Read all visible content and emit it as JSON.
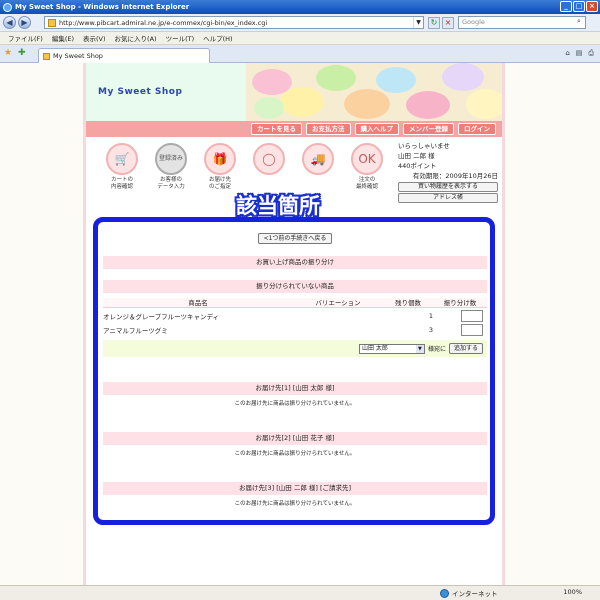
{
  "window": {
    "title": "My Sweet Shop - Windows Internet Explorer"
  },
  "browser": {
    "url": "http://www.pibcart.admiral.ne.jp/e-commex/cgi-bin/ex_index.cgi",
    "search_placeholder": "Google",
    "menu": [
      "ファイル(F)",
      "編集(E)",
      "表示(V)",
      "お気に入り(A)",
      "ツール(T)",
      "ヘルプ(H)"
    ],
    "tab_title": "My Sweet Shop",
    "status_zone": "インターネット",
    "zoom": "100%"
  },
  "shop": {
    "name": "My Sweet Shop",
    "nav": [
      "カートを見る",
      "お支払方法",
      "購入ヘルプ",
      "メンバー登録",
      "ログイン"
    ]
  },
  "steps": [
    {
      "label1": "カートの",
      "label2": "内容確認",
      "icon": "cart-icon",
      "done": false
    },
    {
      "label1": "お客様の",
      "label2": "データ入力",
      "icon": "登録済み",
      "done": true
    },
    {
      "label1": "お届け先",
      "label2": "のご指定",
      "icon": "gift-icon",
      "done": false
    },
    {
      "label1": "",
      "label2": "",
      "icon": "ring-icon",
      "done": false
    },
    {
      "label1": "",
      "label2": "",
      "icon": "truck-icon",
      "done": false
    },
    {
      "label1": "注文の",
      "label2": "最終確認",
      "icon": "ok-icon",
      "done": false
    }
  ],
  "user": {
    "greeting": "いらっしゃいませ",
    "name": "山田 二郎 様",
    "points": "440ポイント",
    "expiry": "有効期限：2009年10月26日",
    "history_btn": "買い物履歴を表示する",
    "address_btn": "アドレス帳"
  },
  "callout": "該当箇所",
  "allocation": {
    "back_btn": "<1つ前の手続きへ戻る",
    "heading": "お買い上げ商品の振り分け",
    "unassigned_heading": "振り分けられていない商品",
    "columns": [
      "商品名",
      "バリエーション",
      "残り個数",
      "振り分け数"
    ],
    "items": [
      {
        "name": "オレンジ＆グレープフルーツキャンディ",
        "variation": "",
        "remaining": "1"
      },
      {
        "name": "アニマルフルーツグミ",
        "variation": "",
        "remaining": "3"
      }
    ],
    "recipient_select": "山田 太郎",
    "select_suffix": "様宛に",
    "add_btn": "追加する",
    "destinations": [
      {
        "title": "お届け先[1] [山田 太郎 様]",
        "note": "このお届け先に商品は振り分けられていません。"
      },
      {
        "title": "お届け先[2] [山田 花子 様]",
        "note": "このお届け先に商品は振り分けられていません。"
      },
      {
        "title": "お届け先[3] [山田 二郎 様] [ご請求先]",
        "note": "このお届け先に商品は振り分けられていません。"
      }
    ]
  },
  "colors": {
    "highlight": "#1520e0",
    "nav": "#f07c7c",
    "band": "#fde1e6"
  }
}
